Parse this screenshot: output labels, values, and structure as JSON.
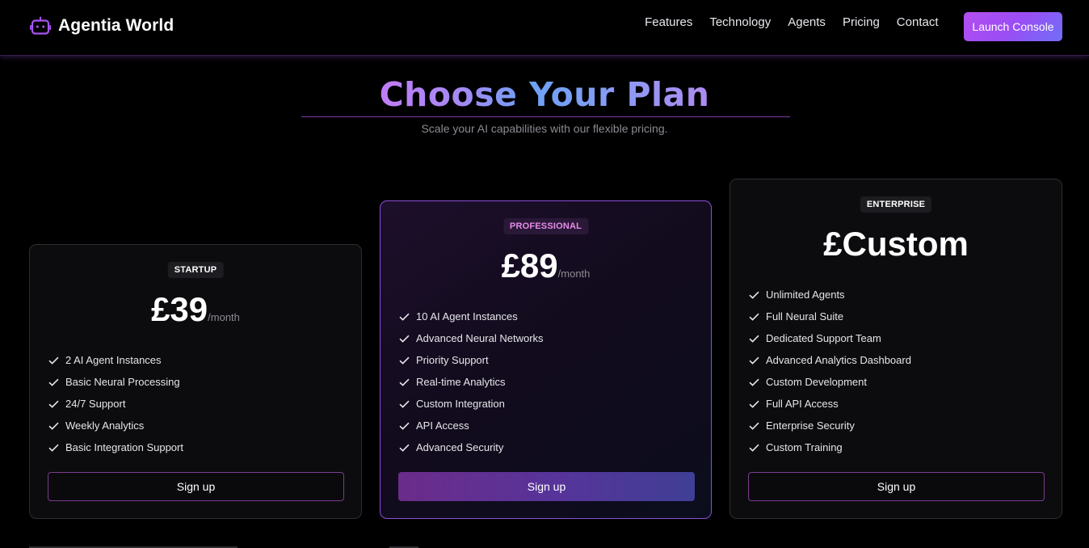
{
  "header": {
    "brand": "Agentia World",
    "nav": [
      "Features",
      "Technology",
      "Agents",
      "Pricing",
      "Contact"
    ],
    "cta": "Launch Console"
  },
  "hero": {
    "title": "Choose Your Plan",
    "subtitle": "Scale your AI capabilities with our flexible pricing."
  },
  "plans": [
    {
      "badge": "STARTUP",
      "price": "£39",
      "period": "/month",
      "features": [
        "2 AI Agent Instances",
        "Basic Neural Processing",
        "24/7 Support",
        "Weekly Analytics",
        "Basic Integration Support"
      ],
      "button": "Sign up"
    },
    {
      "badge": "PROFESSIONAL",
      "price": "£89",
      "period": "/month",
      "features": [
        "10 AI Agent Instances",
        "Advanced Neural Networks",
        "Priority Support",
        "Real-time Analytics",
        "Custom Integration",
        "API Access",
        "Advanced Security"
      ],
      "button": "Sign up"
    },
    {
      "badge": "ENTERPRISE",
      "price": "£Custom",
      "period": "",
      "features": [
        "Unlimited Agents",
        "Full Neural Suite",
        "Dedicated Support Team",
        "Advanced Analytics Dashboard",
        "Custom Development",
        "Full API Access",
        "Enterprise Security",
        "Custom Training"
      ],
      "button": "Sign up"
    }
  ],
  "colors": {
    "accent": "#a855f7",
    "highlight_border": "#8b4fd9",
    "background": "#000000"
  },
  "icons": {
    "brand": "robot-icon",
    "feature": "check-icon"
  }
}
